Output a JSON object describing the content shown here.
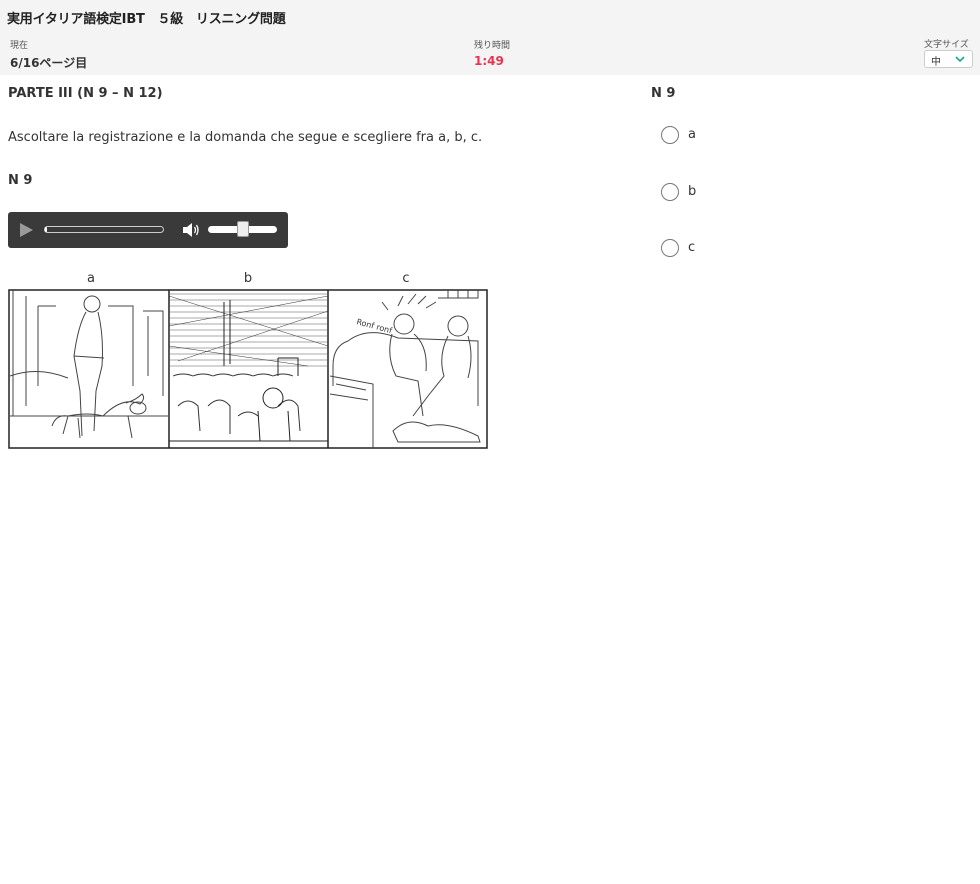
{
  "header": {
    "title": "実用イタリア語検定IBT　５級　リスニング問題",
    "current_label": "現在",
    "current_value": "6/16ページ目",
    "time_label": "残り時間",
    "time_value": "1:49",
    "font_size_label": "文字サイズ",
    "font_size_value": "中"
  },
  "content": {
    "parte": "PARTE III (N 9 – N 12)",
    "instruction": "Ascoltare la registrazione e la domanda che segue e scegliere fra a, b, c.",
    "question_label": "N 9",
    "image_labels": [
      "a",
      "b",
      "c"
    ],
    "image_text": "Ronf ronf"
  },
  "player": {
    "progress": 0.01,
    "volume": 0.5
  },
  "answer": {
    "question_label": "N 9",
    "options": [
      "a",
      "b",
      "c"
    ]
  },
  "colors": {
    "header_bg": "#f4f4f4",
    "timer": "#e8344e",
    "player_bg": "#3a3a3a",
    "chevron": "#1aa89c"
  }
}
